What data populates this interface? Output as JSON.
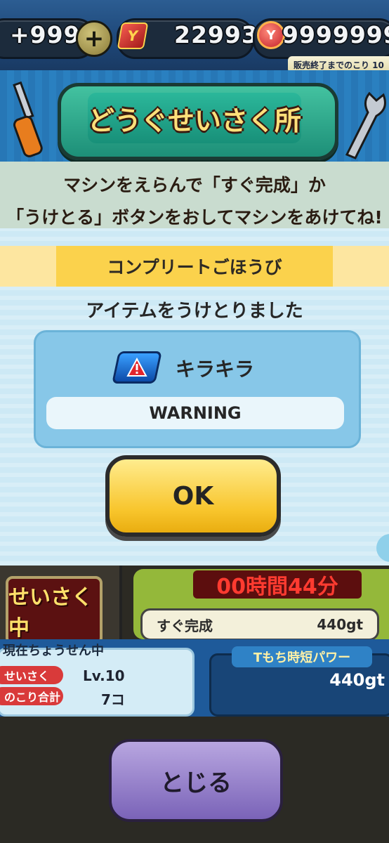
{
  "currency": {
    "stamina": "+999",
    "plus_glyph": "+",
    "y_money": "22993",
    "coins": "9999999",
    "y_badge_glyph": "Y",
    "coin_badge_glyph": "Y",
    "sale_notice": "販売終了までのこり 10"
  },
  "header": {
    "title": "どうぐせいさく所",
    "instruction_line1": "マシンをえらんで「すぐ完成」か",
    "instruction_line2": "「うけとる」ボタンをおしてマシンをあけてね!"
  },
  "modal": {
    "title": "コンプリートごほうび",
    "message": "アイテムをうけとりました",
    "item_name": "キラキラ",
    "item_description": "WARNING",
    "ok_label": "OK"
  },
  "background": {
    "machine_sign": "せいさく中",
    "timer": "00時間44分",
    "quick_complete_label": "すぐ完成",
    "quick_complete_cost": "440gt",
    "challenge_title": "現在ちょうせん中",
    "crafting_label": "せいさく",
    "crafting_level": "Lv.10",
    "remaining_label": "のこり合計",
    "remaining_count": "7コ",
    "power_label": "Tもち時短パワー",
    "power_value": "440gt",
    "close_label": "とじる"
  },
  "colors": {
    "modal_bg": "#cde9f5",
    "title_bar": "#fbd24c",
    "ok_button": "#f8c52c",
    "item_box": "#87c7e8"
  }
}
